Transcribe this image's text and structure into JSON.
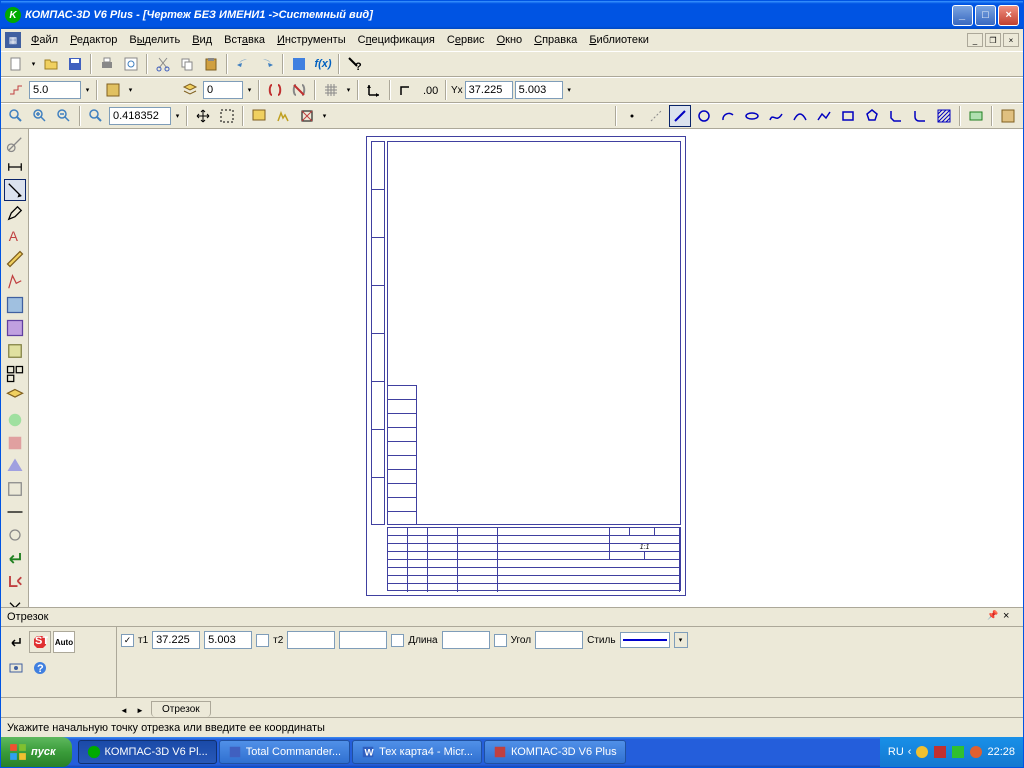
{
  "titlebar": {
    "app_name": "КОМПАС-3D V6 Plus",
    "doc_name": "[Чертеж БЕЗ ИМЕНИ1 ->Системный вид]",
    "full_title": "КОМПАС-3D V6 Plus - [Чертеж БЕЗ ИМЕНИ1 ->Системный вид]"
  },
  "menu": {
    "file": "Файл",
    "editor": "Редактор",
    "select": "Выделить",
    "view": "Вид",
    "insert": "Вставка",
    "tools": "Инструменты",
    "spec": "Спецификация",
    "service": "Сервис",
    "window": "Окно",
    "help": "Справка",
    "libs": "Библиотеки"
  },
  "toolbar": {
    "step_value": "5.0",
    "layer_value": "0",
    "coord_x_label": "Yx",
    "coord_x": "37.225",
    "coord_y": "5.003",
    "zoom_value": "0.418352",
    "fx_label": "f(x)"
  },
  "properties": {
    "title": "Отрезок",
    "t1_label": "т1",
    "t2_label": "т2",
    "t1_x": "37.225",
    "t1_y": "5.003",
    "t2_x": "",
    "t2_y": "",
    "length_label": "Длина",
    "length": "",
    "angle_label": "Угол",
    "angle": "",
    "style_label": "Стиль",
    "tab": "Отрезок",
    "auto_label": "Auto",
    "stop_label": "STOP"
  },
  "statusbar": {
    "hint": "Укажите начальную точку отрезка или введите ее координаты"
  },
  "taskbar": {
    "start": "пуск",
    "items": [
      "КОМПАС-3D V6 Pl...",
      "Total Commander...",
      "Тех карта4 - Micr...",
      "КОМПАС-3D V6 Plus"
    ],
    "lang": "RU",
    "time": "22:28"
  }
}
